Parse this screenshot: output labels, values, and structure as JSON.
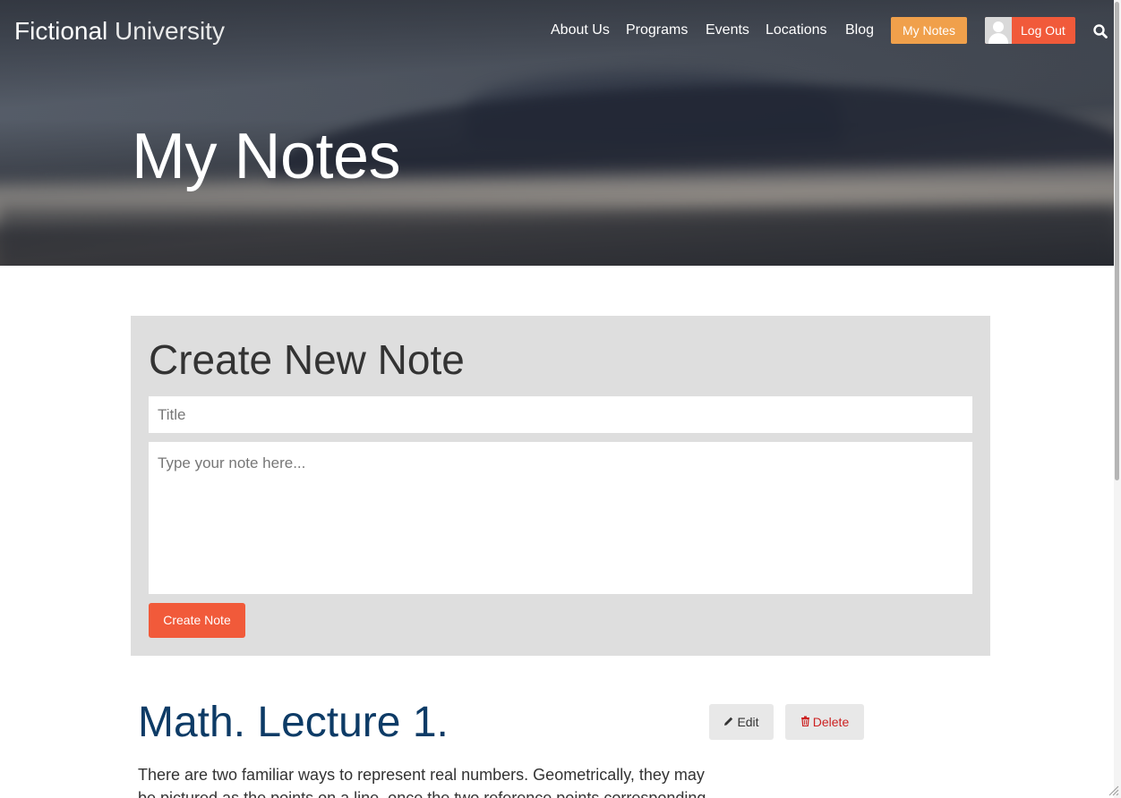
{
  "site": {
    "name_bold": "Fictional",
    "name_light": "University"
  },
  "nav": {
    "items": [
      "About Us",
      "Programs",
      "Events",
      "Locations",
      "Blog"
    ],
    "my_notes": "My Notes",
    "log_out": "Log Out"
  },
  "hero": {
    "title": "My Notes"
  },
  "create": {
    "heading": "Create New Note",
    "title_placeholder": "Title",
    "body_placeholder": "Type your note here...",
    "submit": "Create Note"
  },
  "note": {
    "title": "Math. Lecture 1.",
    "edit": "Edit",
    "delete": "Delete",
    "body": "There are two familiar ways to represent real numbers. Geometrically, they may be pictured as the points on a line, once the two reference points corresponding"
  },
  "colors": {
    "accent_orange": "#f0a04b",
    "accent_red": "#f15a3a",
    "note_title_blue": "#0d3b66",
    "delete_red": "#cc2222",
    "panel_gray": "#dedede"
  },
  "icons": [
    "search-icon",
    "pencil-icon",
    "trash-icon",
    "avatar-icon"
  ]
}
